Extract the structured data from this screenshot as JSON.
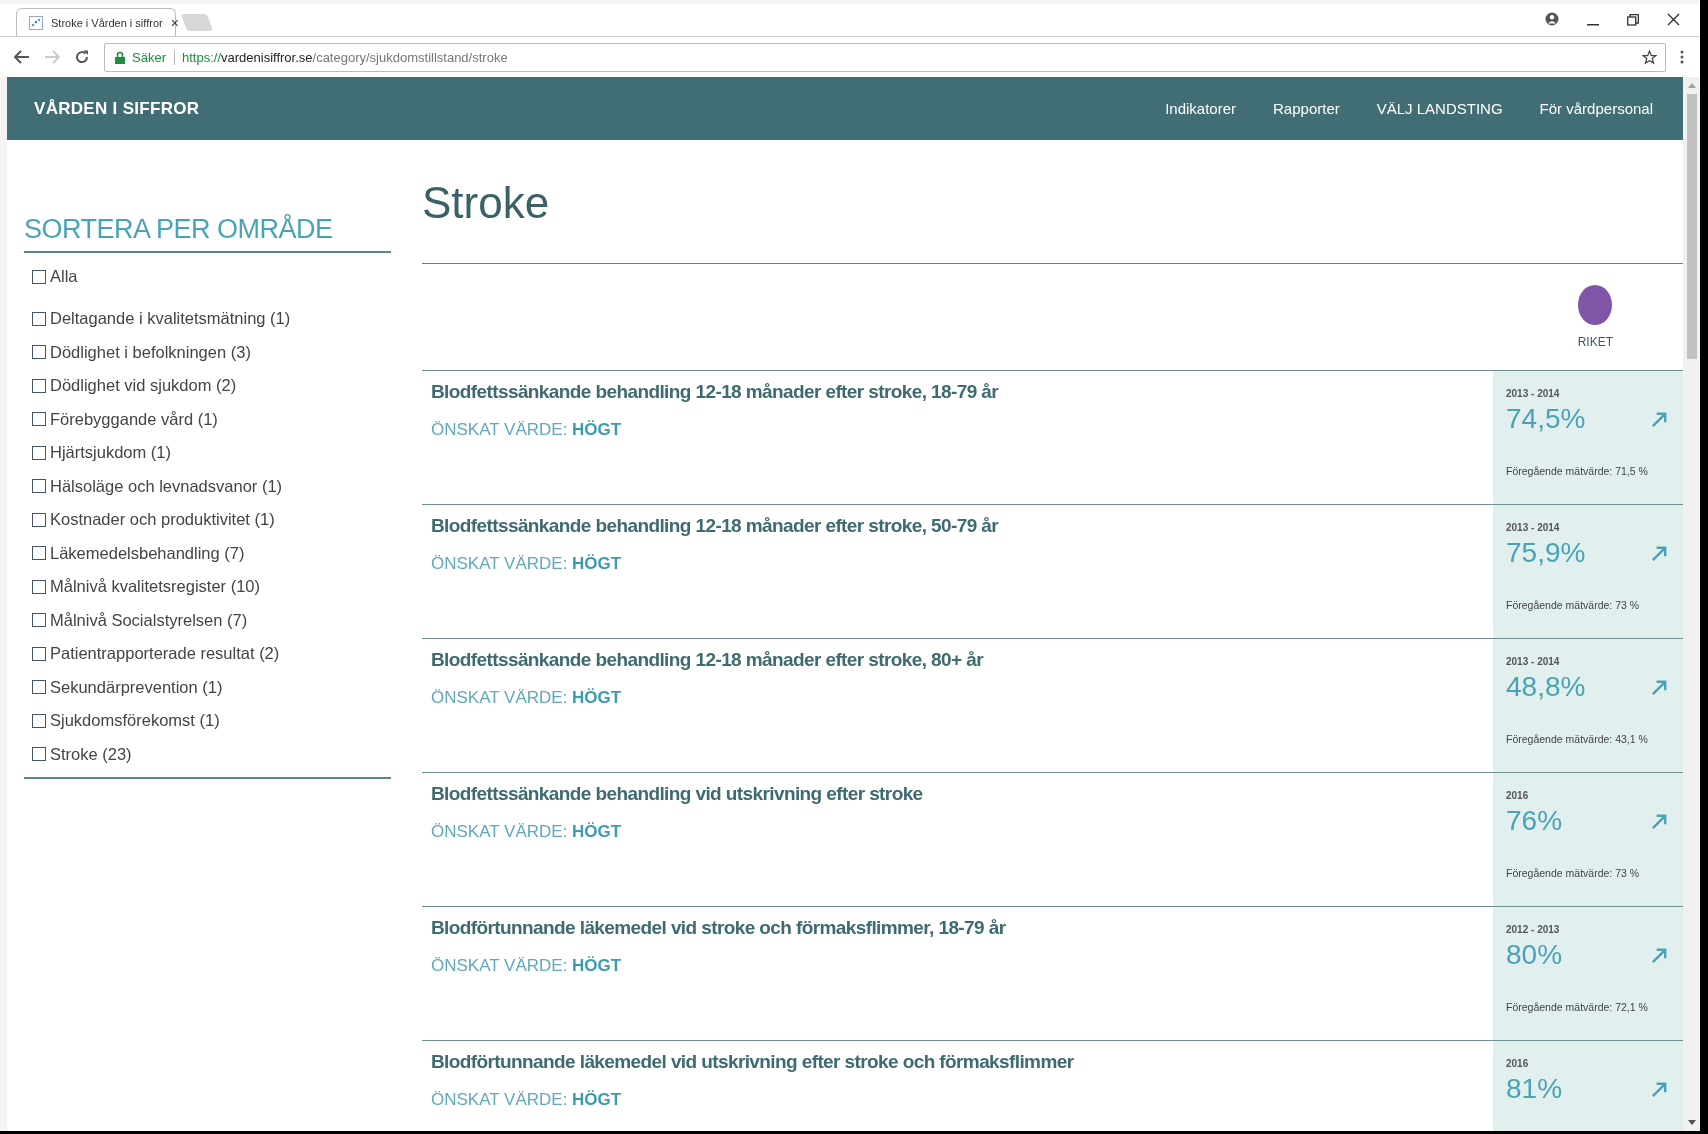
{
  "browser": {
    "tab": {
      "title": "Stroke i Vården i siffror",
      "close": "×"
    },
    "security": "Säker",
    "url": {
      "scheme": "https://",
      "host": "vardenisiffror.se",
      "path": "/category/sjukdomstillstand/stroke"
    }
  },
  "header": {
    "logo": "VÅRDEN I SIFFROR",
    "nav": [
      {
        "label": "Indikatorer"
      },
      {
        "label": "Rapporter"
      },
      {
        "label": "VÄLJ LANDSTING"
      },
      {
        "label": "För vårdpersonal"
      }
    ]
  },
  "sidebar": {
    "title": "SORTERA PER OMRÅDE",
    "items": [
      {
        "label": "Alla",
        "checked": false
      },
      {
        "label": "Deltagande i kvalitetsmätning (1)",
        "checked": false
      },
      {
        "label": "Dödlighet i befolkningen (3)",
        "checked": false
      },
      {
        "label": "Dödlighet vid sjukdom (2)",
        "checked": false
      },
      {
        "label": "Förebyggande vård (1)",
        "checked": false
      },
      {
        "label": "Hjärtsjukdom (1)",
        "checked": false
      },
      {
        "label": "Hälsoläge och levnadsvanor (1)",
        "checked": false
      },
      {
        "label": "Kostnader och produktivitet (1)",
        "checked": false
      },
      {
        "label": "Läkemedelsbehandling (7)",
        "checked": false
      },
      {
        "label": "Målnivå kvalitetsregister (10)",
        "checked": false
      },
      {
        "label": "Målnivå Socialstyrelsen (7)",
        "checked": false
      },
      {
        "label": "Patientrapporterade resultat (2)",
        "checked": false
      },
      {
        "label": "Sekundärprevention (1)",
        "checked": false
      },
      {
        "label": "Sjukdomsförekomst (1)",
        "checked": false
      },
      {
        "label": "Stroke (23)",
        "checked": false
      }
    ]
  },
  "main": {
    "title": "Stroke",
    "legend": [
      {
        "label": "RIKET",
        "color": "#7f55a8"
      }
    ],
    "indicators": [
      {
        "title": "Blodfettssänkande behandling 12-18 månader efter stroke, 18-79 år",
        "desired": "ÖNSKAT VÄRDE: **HÖGT**",
        "period": "2013 - 2014",
        "value": "74,5%",
        "kind": "rising",
        "previous": "Föregående mätvärde: 71,5 %"
      },
      {
        "title": "Blodfettssänkande behandling 12-18 månader efter stroke, 50-79 år",
        "desired": "ÖNSKAT VÄRDE: **HÖGT**",
        "period": "2013 - 2014",
        "value": "75,9%",
        "kind": "rising",
        "previous": "Föregående mätvärde: 73 %"
      },
      {
        "title": "Blodfettssänkande behandling 12-18 månader efter stroke, 80+ år",
        "desired": "ÖNSKAT VÄRDE: **HÖGT**",
        "period": "2013 - 2014",
        "value": "48,8%",
        "kind": "rising",
        "previous": "Föregående mätvärde: 43,1 %"
      },
      {
        "title": "Blodfettssänkande behandling vid utskrivning efter stroke",
        "desired": "ÖNSKAT VÄRDE: **HÖGT**",
        "period": "2016",
        "value": "76%",
        "kind": "rising",
        "previous": "Föregående mätvärde: 73 %"
      },
      {
        "title": "Blodförtunnande läkemedel vid stroke och förmaksflimmer, 18-79 år",
        "desired": "ÖNSKAT VÄRDE: **HÖGT**",
        "period": "2012 - 2013",
        "value": "80%",
        "kind": "rising",
        "previous": "Föregående mätvärde: 72,1 %"
      },
      {
        "title": "Blodförtunnande läkemedel vid utskrivning efter stroke och förmaksflimmer",
        "desired": "ÖNSKAT VÄRDE: **HÖGT**",
        "period": "2016",
        "value": "81%",
        "kind": "rising"
      }
    ]
  }
}
